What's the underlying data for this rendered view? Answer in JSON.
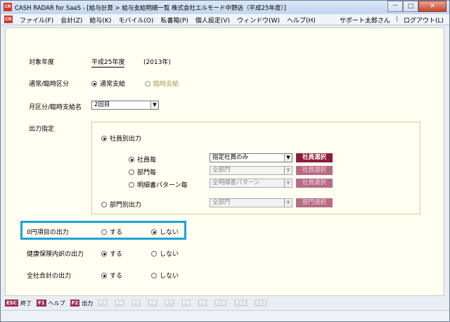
{
  "titlebar": {
    "app_icon": "CR",
    "title": "CASH RADAR for SaaS - [給与計算 > 給与支給明細一覧 株式会社エルモード中野店（平成25年度）]"
  },
  "window_buttons": {
    "minimize": "－",
    "maximize": "□",
    "close": "✕"
  },
  "menubar": {
    "icon": "CR",
    "items": [
      "ファイル(F)",
      "会計(Z)",
      "給与(K)",
      "モバイル(O)",
      "私書箱(P)",
      "個人設定(V)",
      "ウィンドウ(W)",
      "ヘルプ(H)"
    ],
    "user": "サポート太郎さん",
    "separator": "|",
    "logout": "ログアウト(L)"
  },
  "form": {
    "year_label": "対象年度",
    "year_value": "平成25年度",
    "year_western": "(2013年)",
    "pay_type_label": "通常/臨時区分",
    "pay_type_options": [
      "通常支給",
      "臨時支給"
    ],
    "month_label": "月区分/臨時支給名",
    "month_value": "2回目",
    "output_label": "出力指定",
    "by_employee": "社員別出力",
    "per_employee": "社員毎",
    "per_employee_select": "指定社員のみ",
    "per_employee_btn": "社員選択",
    "per_dept": "部門毎",
    "per_dept_select": "全部門",
    "per_dept_btn": "社員選択",
    "per_pattern": "明細書パターン毎",
    "per_pattern_select": "全明細書パターン",
    "per_pattern_btn": "社員選択",
    "by_dept": "部門別出力",
    "by_dept_select": "全部門",
    "by_dept_btn": "部門選択",
    "zero_label": "0円項目の出力",
    "health_label": "健康保険内訳の出力",
    "total_label": "全社合計の出力",
    "yes": "する",
    "no": "しない"
  },
  "fnbar": [
    {
      "key": "ESC",
      "label": "終了",
      "active": true
    },
    {
      "key": "F1",
      "label": "ヘルプ",
      "active": true
    },
    {
      "key": "F2",
      "label": "出力",
      "active": true
    },
    {
      "key": "F3",
      "label": "",
      "active": false
    },
    {
      "key": "F4",
      "label": "",
      "active": false
    },
    {
      "key": "F5",
      "label": "",
      "active": false
    },
    {
      "key": "F6",
      "label": "",
      "active": false
    },
    {
      "key": "F7",
      "label": "",
      "active": false
    },
    {
      "key": "F8",
      "label": "",
      "active": false
    },
    {
      "key": "F9",
      "label": "",
      "active": false
    },
    {
      "key": "F10",
      "label": "",
      "active": false
    },
    {
      "key": "F11",
      "label": "",
      "active": false
    },
    {
      "key": "F12",
      "label": "",
      "active": false
    }
  ],
  "colors": {
    "accent_button": "#8a1f3c",
    "highlight_box": "#1ba3d8"
  }
}
